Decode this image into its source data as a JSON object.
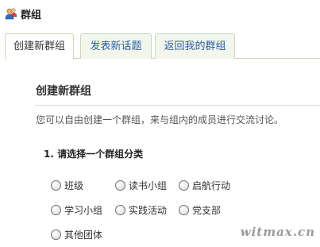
{
  "header": {
    "title": "群组",
    "icon": "group-people-icon"
  },
  "tabs": [
    {
      "label": "创建新群组",
      "active": true
    },
    {
      "label": "发表新话题",
      "active": false
    },
    {
      "label": "返回我的群组",
      "active": false
    }
  ],
  "main": {
    "section_title": "创建新群组",
    "description": "您可以自由创建一个群组，来与组内的成员进行交流讨论。",
    "question": "1. 请选择一个群组分类",
    "options": [
      "班级",
      "读书小组",
      "启航行动",
      "学习小组",
      "实践活动",
      "党支部",
      "其他团体"
    ]
  },
  "watermark": "witmax.cn",
  "colors": {
    "link": "#2a5f9e",
    "tab_border": "#c9d7c0",
    "tab_bg": "#f3f6ec"
  }
}
